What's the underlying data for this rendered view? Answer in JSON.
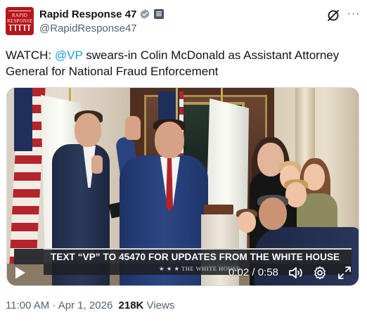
{
  "account": {
    "display_name": "Rapid Response 47",
    "handle": "@RapidResponse47",
    "avatar_text_line1": "RAPID",
    "avatar_text_line2": "RESPONSE"
  },
  "tweet": {
    "text_prefix": "WATCH: ",
    "mention": "@VP",
    "text_suffix": " swears-in Colin McDonald as Assistant Attorney General for National Fraud Enforcement"
  },
  "video": {
    "banner_text": "TEXT “VP” TO 45470 FOR UPDATES FROM THE WHITE HOUSE",
    "source_label": "★ ★ ★   THE WHITE HOUSE",
    "time_display": "0:02 / 0:58",
    "progress": 0.03
  },
  "meta": {
    "time": "11:00 AM",
    "separator": " · ",
    "date": "Apr 1, 2026",
    "views_count": "218K",
    "views_label": " Views"
  },
  "icons": {
    "verified": "verified-badge-icon",
    "government": "government-badge-icon",
    "grok": "grok-icon",
    "more": "more-icon",
    "play": "play-icon",
    "volume": "volume-icon",
    "settings": "settings-icon",
    "fullscreen": "fullscreen-icon"
  },
  "colors": {
    "link": "#1d9bf0",
    "verified": "#1d9bf0",
    "text": "#0f1419",
    "secondary": "#536471"
  }
}
